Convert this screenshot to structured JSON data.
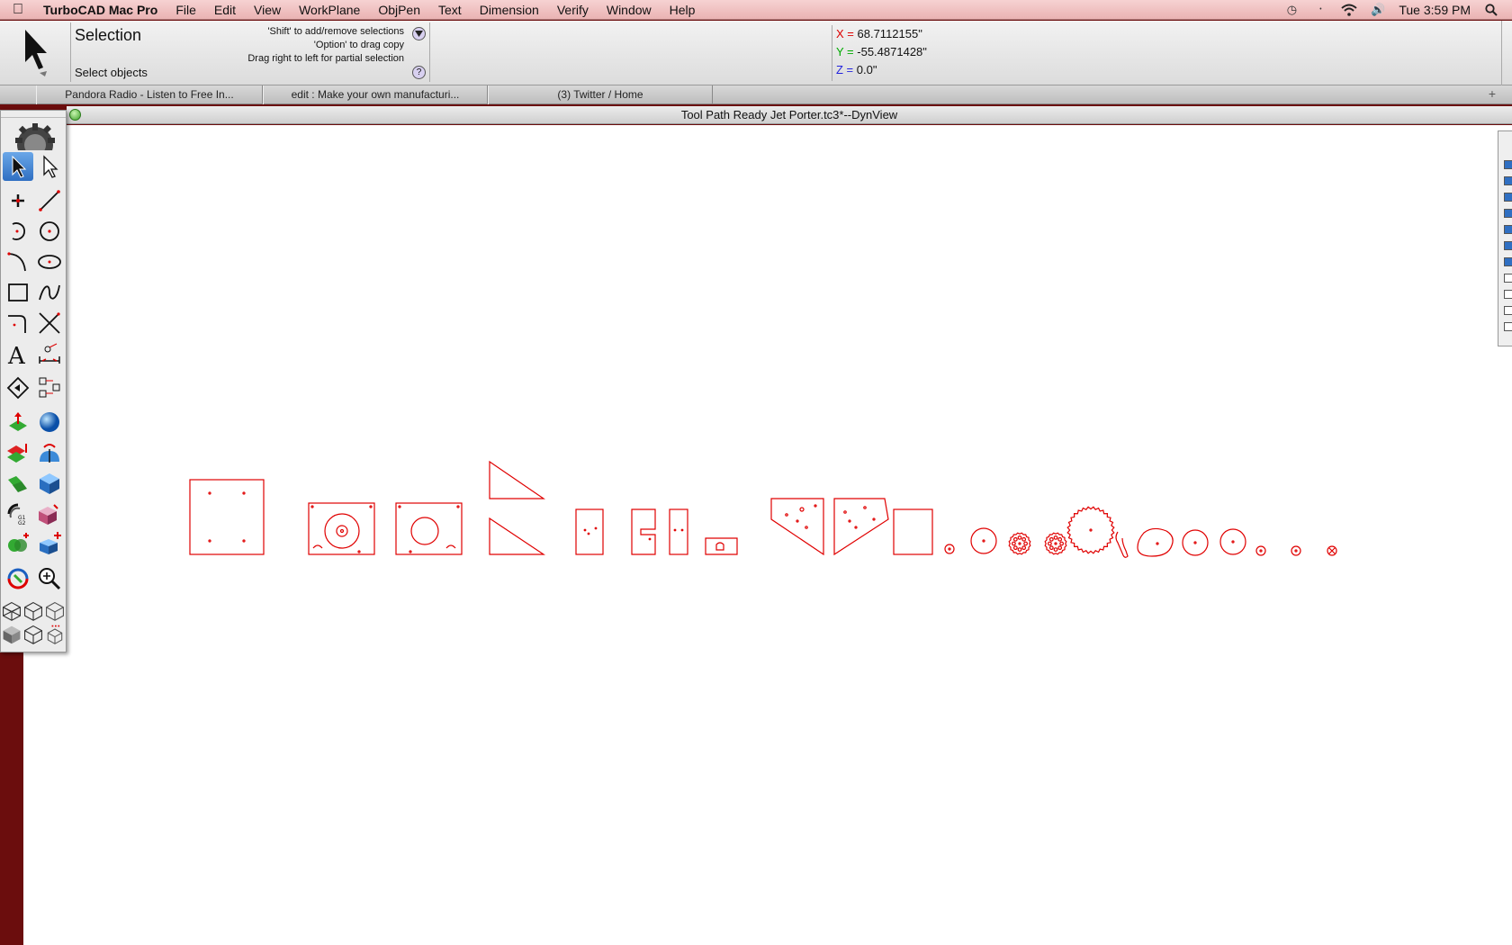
{
  "menubar": {
    "app_name": "TurboCAD Mac Pro",
    "items": [
      "File",
      "Edit",
      "View",
      "WorkPlane",
      "ObjPen",
      "Text",
      "Dimension",
      "Verify",
      "Window",
      "Help"
    ],
    "clock": "Tue 3:59 PM"
  },
  "inspector": {
    "title": "Selection",
    "subtitle": "Select objects",
    "hints": [
      "'Shift' to add/remove selections",
      "'Option' to drag copy",
      "Drag right to left for partial selection"
    ],
    "help_glyph": "?",
    "coords": {
      "x_label": "X =",
      "x_value": "68.7112155\"",
      "y_label": "Y =",
      "y_value": "-55.4871428\"",
      "z_label": "Z =",
      "z_value": "0.0\""
    }
  },
  "tabs": [
    {
      "label": "Pandora Radio - Listen to Free In..."
    },
    {
      "label": "edit : Make your own manufacturi..."
    },
    {
      "label": "(3) Twitter / Home"
    }
  ],
  "tab_plus": "+",
  "document": {
    "title": "Tool Path Ready Jet Porter.tc3*--DynView",
    "stroke_color": "#e00000"
  },
  "layers": {
    "checked": [
      true,
      true,
      true,
      true,
      true,
      true,
      true,
      false,
      false,
      false,
      false
    ]
  },
  "colors": {
    "desktop": "#6b0d0d",
    "menubar": "#eab3b3",
    "selection": "#2f6fc2"
  }
}
